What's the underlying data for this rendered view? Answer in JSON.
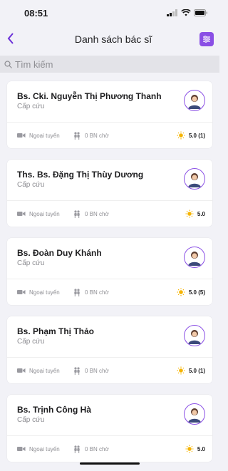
{
  "status_bar": {
    "time": "08:51"
  },
  "nav": {
    "title": "Danh sách bác sĩ",
    "back_icon": "chevron-left-icon",
    "filter_icon": "sliders-icon"
  },
  "search": {
    "placeholder": "Tìm kiếm"
  },
  "colors": {
    "accent": "#8a4fe5",
    "back": "#6a2fd8",
    "sun": "#f5b400"
  },
  "doctors": [
    {
      "name": "Bs. Cki. Nguyễn Thị Phương Thanh",
      "specialty": "Cấp cứu",
      "status": "Ngoại tuyến",
      "waiting": "0 BN chờ",
      "rating": "5.0 (1)"
    },
    {
      "name": "Ths. Bs. Đặng Thị Thùy Dương",
      "specialty": "Cấp cứu",
      "status": "Ngoại tuyến",
      "waiting": "0 BN chờ",
      "rating": "5.0"
    },
    {
      "name": "Bs. Đoàn Duy Khánh",
      "specialty": "Cấp cứu",
      "status": "Ngoại tuyến",
      "waiting": "0 BN chờ",
      "rating": "5.0 (5)"
    },
    {
      "name": "Bs. Phạm Thị Thảo",
      "specialty": "Cấp cứu",
      "status": "Ngoại tuyến",
      "waiting": "0 BN chờ",
      "rating": "5.0 (1)"
    },
    {
      "name": "Bs. Trịnh Công Hà",
      "specialty": "Cấp cứu",
      "status": "Ngoại tuyến",
      "waiting": "0 BN chờ",
      "rating": "5.0"
    }
  ]
}
